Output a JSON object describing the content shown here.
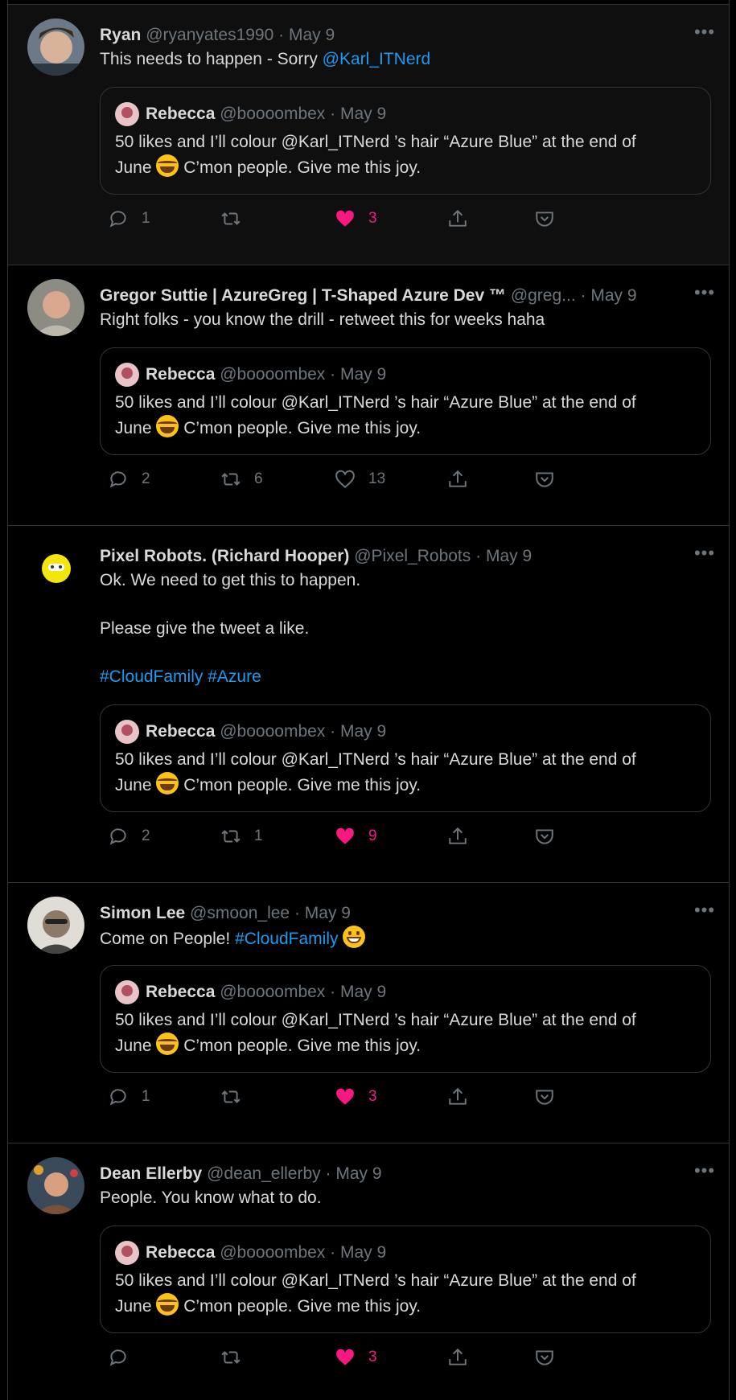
{
  "tweets": [
    {
      "name": "Ryan",
      "handle": "@ryanyates1990",
      "date": "May 9",
      "text_parts": [
        "This needs to happen - Sorry ",
        "@Karl_ITNerd"
      ],
      "replies": "1",
      "retweets": "",
      "likes": "3",
      "liked": true,
      "avatar": "ryan-avatar"
    },
    {
      "name": "Gregor Suttie | AzureGreg | T-Shaped Azure Dev ™",
      "handle": "@greg...",
      "date": "May 9",
      "text": "Right folks - you know the drill - retweet this for weeks haha",
      "replies": "2",
      "retweets": "6",
      "likes": "13",
      "liked": false,
      "avatar": "gregor-avatar"
    },
    {
      "name": "Pixel Robots. (Richard Hooper)",
      "handle": "@Pixel_Robots",
      "date": "May 9",
      "text_lines": [
        "Ok. We need to get this to happen.",
        "Please give the tweet a like."
      ],
      "hashtags": [
        "#CloudFamily",
        "#Azure"
      ],
      "replies": "2",
      "retweets": "1",
      "likes": "9",
      "liked": true,
      "avatar": "pixel-robots-avatar"
    },
    {
      "name": "Simon Lee",
      "handle": "@smoon_lee",
      "date": "May 9",
      "text_parts": [
        "Come on People! ",
        "#CloudFamily"
      ],
      "replies": "1",
      "retweets": "",
      "likes": "3",
      "liked": true,
      "avatar": "simon-avatar"
    },
    {
      "name": "Dean Ellerby",
      "handle": "@dean_ellerby",
      "date": "May 9",
      "text": "People. You know what to do.",
      "replies": "",
      "retweets": "",
      "likes": "3",
      "liked": true,
      "avatar": "dean-avatar"
    }
  ],
  "quote": {
    "name": "Rebecca",
    "handle": "@boooombex",
    "date": "May 9",
    "line1": "50 likes and I’ll colour @Karl_ITNerd ’s hair “Azure Blue” at the end of",
    "line2_a": "June ",
    "line2_b": " C’mon people. Give me this joy."
  },
  "separator": "·",
  "more_label": "•••",
  "colors": {
    "background": "#000000",
    "link": "#1d9bf0",
    "like": "#f91880",
    "muted": "#6e767d",
    "border": "#2f3336"
  }
}
